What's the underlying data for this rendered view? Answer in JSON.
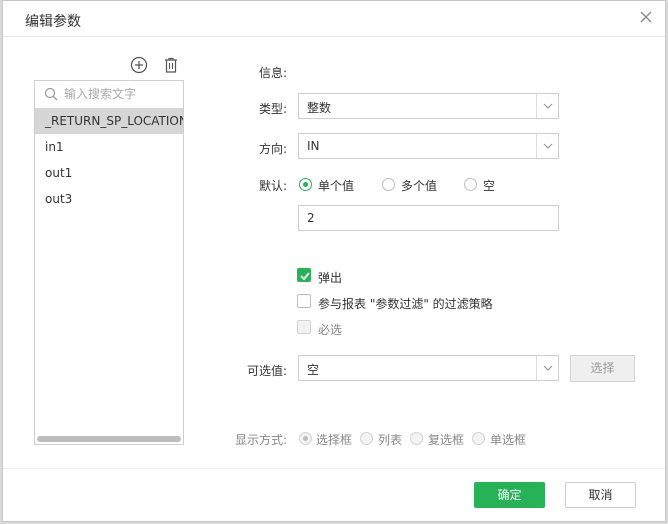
{
  "dialog": {
    "title": "编辑参数"
  },
  "left": {
    "search_placeholder": "输入搜索文字",
    "params": [
      "_RETURN_SP_LOCATION_",
      "in1",
      "out1",
      "out3"
    ],
    "selected_index": 0
  },
  "form": {
    "info_label": "信息:",
    "type_label": "类型:",
    "type_value": "整数",
    "direction_label": "方向:",
    "direction_value": "IN",
    "default_label": "默认:",
    "default_options": [
      "单个值",
      "多个值",
      "空"
    ],
    "default_selected": 0,
    "default_value": "2",
    "popup_label": "弹出",
    "popup_checked": true,
    "participate_label": "参与报表 \"参数过滤\" 的过滤策略",
    "required_label": "必选",
    "optional_label": "可选值:",
    "optional_value": "空",
    "choose_button": "选择",
    "display_label": "显示方式:",
    "display_options": [
      "选择框",
      "列表",
      "复选框",
      "单选框"
    ],
    "display_selected": 0
  },
  "footer": {
    "ok": "确定",
    "cancel": "取消"
  },
  "colors": {
    "accent": "#27b257"
  }
}
